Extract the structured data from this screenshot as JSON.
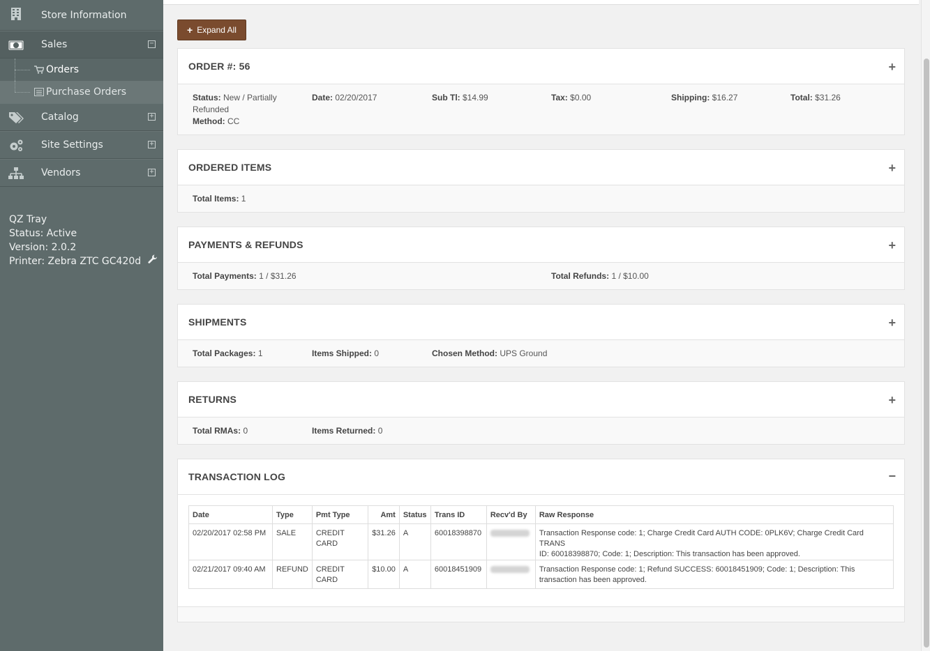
{
  "sidebar": {
    "items": [
      {
        "label": "Store Information",
        "icon": "building-icon"
      },
      {
        "label": "Sales",
        "icon": "money-icon",
        "toggle": "−"
      },
      {
        "label": "Catalog",
        "icon": "tags-icon",
        "toggle": "+"
      },
      {
        "label": "Site Settings",
        "icon": "gears-icon",
        "toggle": "+"
      },
      {
        "label": "Vendors",
        "icon": "sitemap-icon",
        "toggle": "+"
      }
    ],
    "subitems": [
      {
        "label": "Orders",
        "icon": "cart-icon"
      },
      {
        "label": "Purchase Orders",
        "icon": "list-icon"
      }
    ],
    "qz": {
      "title": "QZ Tray",
      "status": "Status: Active",
      "version": "Version: 2.0.2",
      "printer": "Printer: Zebra ZTC GC420d"
    }
  },
  "toolbar": {
    "expand_label": "Expand All"
  },
  "order": {
    "title": "ORDER #: 56",
    "status_label": "Status:",
    "status_value": "New / Partially",
    "status_value2": "Refunded",
    "method_label": "Method:",
    "method_value": "CC",
    "date_label": "Date:",
    "date_value": "02/20/2017",
    "subtotal_label": "Sub Tl:",
    "subtotal_value": "$14.99",
    "tax_label": "Tax:",
    "tax_value": "$0.00",
    "shipping_label": "Shipping:",
    "shipping_value": "$16.27",
    "total_label": "Total:",
    "total_value": "$31.26"
  },
  "ordered_items": {
    "title": "ORDERED ITEMS",
    "total_label": "Total Items:",
    "total_value": "1"
  },
  "payments": {
    "title": "PAYMENTS & REFUNDS",
    "payments_label": "Total Payments:",
    "payments_value": "1 / $31.26",
    "refunds_label": "Total Refunds:",
    "refunds_value": "1 / $10.00"
  },
  "shipments": {
    "title": "SHIPMENTS",
    "packages_label": "Total Packages:",
    "packages_value": "1",
    "shipped_label": "Items Shipped:",
    "shipped_value": "0",
    "method_label": "Chosen Method:",
    "method_value": "UPS Ground"
  },
  "returns": {
    "title": "RETURNS",
    "rmas_label": "Total RMAs:",
    "rmas_value": "0",
    "returned_label": "Items Returned:",
    "returned_value": "0"
  },
  "transaction_log": {
    "title": "TRANSACTION LOG",
    "columns": [
      "Date",
      "Type",
      "Pmt Type",
      "Amt",
      "Status",
      "Trans ID",
      "Recv'd By",
      "Raw Response"
    ],
    "rows": [
      {
        "date": "02/20/2017 02:58 PM",
        "type": "SALE",
        "pmt_type": "CREDIT CARD",
        "amt": "$31.26",
        "status": "A",
        "trans_id": "60018398870",
        "raw1": "Transaction Response code: 1; Charge Credit Card AUTH CODE: 0PLK6V; Charge Credit Card TRANS",
        "raw2": "ID: 60018398870; Code: 1; Description: This transaction has been approved."
      },
      {
        "date": "02/21/2017 09:40 AM",
        "type": "REFUND",
        "pmt_type": "CREDIT CARD",
        "amt": "$10.00",
        "status": "A",
        "trans_id": "60018451909",
        "raw1": "Transaction Response code: 1; Refund SUCCESS: 60018451909; Code: 1; Description: This",
        "raw2": "transaction has been approved."
      }
    ]
  },
  "colors": {
    "sidebar": "#5e6b6b",
    "button": "#7a4b2e",
    "panel_body": "#f9f9f9"
  }
}
